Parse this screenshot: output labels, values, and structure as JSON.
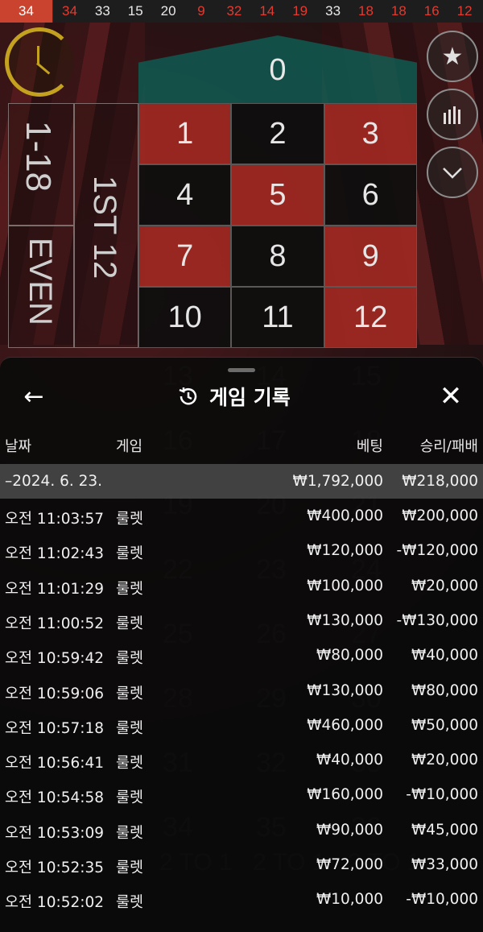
{
  "history_strip": [
    {
      "value": "34",
      "color": "red",
      "latest": true
    },
    {
      "value": "34",
      "color": "red"
    },
    {
      "value": "33",
      "color": "black"
    },
    {
      "value": "15",
      "color": "black"
    },
    {
      "value": "20",
      "color": "black"
    },
    {
      "value": "9",
      "color": "red"
    },
    {
      "value": "32",
      "color": "red"
    },
    {
      "value": "14",
      "color": "red"
    },
    {
      "value": "19",
      "color": "red"
    },
    {
      "value": "33",
      "color": "black"
    },
    {
      "value": "18",
      "color": "red"
    },
    {
      "value": "18",
      "color": "red"
    },
    {
      "value": "16",
      "color": "red"
    },
    {
      "value": "12",
      "color": "red"
    }
  ],
  "table": {
    "zero": "0",
    "range_label": "1-18",
    "even_label": "EVEN",
    "dozen_label": "1ST 12",
    "numbers": [
      {
        "n": "1",
        "c": "red"
      },
      {
        "n": "2",
        "c": "black"
      },
      {
        "n": "3",
        "c": "red"
      },
      {
        "n": "4",
        "c": "black"
      },
      {
        "n": "5",
        "c": "red"
      },
      {
        "n": "6",
        "c": "black"
      },
      {
        "n": "7",
        "c": "red"
      },
      {
        "n": "8",
        "c": "black"
      },
      {
        "n": "9",
        "c": "red"
      },
      {
        "n": "10",
        "c": "black"
      },
      {
        "n": "11",
        "c": "black"
      },
      {
        "n": "12",
        "c": "red"
      }
    ]
  },
  "panel": {
    "title": "게임 기록",
    "back_icon": "←",
    "close_icon": "✕",
    "headers": {
      "date": "날짜",
      "game": "게임",
      "bet": "베팅",
      "result": "승리/패배"
    },
    "summary": {
      "date": "–2024. 6. 23.",
      "bet": "₩1,792,000",
      "result": "₩218,000"
    },
    "rows": [
      {
        "time": "오전 11:03:57",
        "game": "룰렛",
        "bet": "₩400,000",
        "result": "₩200,000"
      },
      {
        "time": "오전 11:02:43",
        "game": "룰렛",
        "bet": "₩120,000",
        "result": "-₩120,000"
      },
      {
        "time": "오전 11:01:29",
        "game": "룰렛",
        "bet": "₩100,000",
        "result": "₩20,000"
      },
      {
        "time": "오전 11:00:52",
        "game": "룰렛",
        "bet": "₩130,000",
        "result": "-₩130,000"
      },
      {
        "time": "오전 10:59:42",
        "game": "룰렛",
        "bet": "₩80,000",
        "result": "₩40,000"
      },
      {
        "time": "오전 10:59:06",
        "game": "룰렛",
        "bet": "₩130,000",
        "result": "₩80,000"
      },
      {
        "time": "오전 10:57:18",
        "game": "룰렛",
        "bet": "₩460,000",
        "result": "₩50,000"
      },
      {
        "time": "오전 10:56:41",
        "game": "룰렛",
        "bet": "₩40,000",
        "result": "₩20,000"
      },
      {
        "time": "오전 10:54:58",
        "game": "룰렛",
        "bet": "₩160,000",
        "result": "-₩10,000"
      },
      {
        "time": "오전 10:53:09",
        "game": "룰렛",
        "bet": "₩90,000",
        "result": "₩45,000"
      },
      {
        "time": "오전 10:52:35",
        "game": "룰렛",
        "bet": "₩72,000",
        "result": "₩33,000"
      },
      {
        "time": "오전 10:52:02",
        "game": "룰렛",
        "bet": "₩10,000",
        "result": "-₩10,000"
      }
    ]
  },
  "ghost_numbers": [
    "13",
    "14",
    "15",
    "16",
    "17",
    "18",
    "19",
    "20",
    "21",
    "22",
    "23",
    "24",
    "25",
    "26",
    "27",
    "28",
    "29",
    "30",
    "31",
    "32",
    "33",
    "34",
    "35",
    "36"
  ],
  "ghost_two_to_one": "2 TO 1",
  "colors": {
    "red": "#a0281f",
    "black": "#0e0e0e",
    "zero_green": "#0f5a51",
    "gold": "#c4a21f",
    "strip_latest": "#c9432f"
  },
  "icons": {
    "clock": "clock-icon",
    "favorite": "star-icon",
    "stats": "bar-chart-icon",
    "collapse": "chevron-down-icon",
    "history": "history-icon"
  }
}
